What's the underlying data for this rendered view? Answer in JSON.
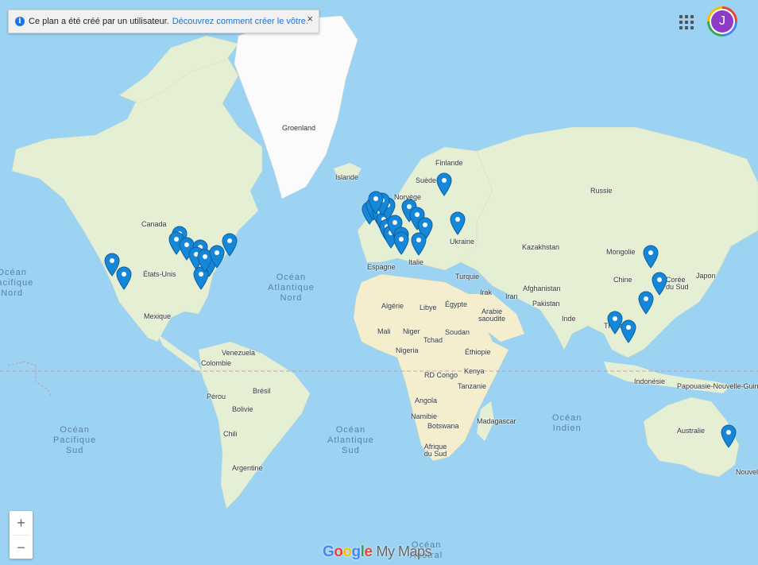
{
  "notice": {
    "text": "Ce plan a été créé par un utilisateur.",
    "link": "Découvrez comment créer le vôtre.",
    "close": "×",
    "info": "i"
  },
  "account": {
    "initial": "J"
  },
  "zoom": {
    "in": "+",
    "out": "−"
  },
  "brand": {
    "letters": [
      {
        "ch": "G",
        "color": "#4285f4"
      },
      {
        "ch": "o",
        "color": "#ea4335"
      },
      {
        "ch": "o",
        "color": "#fbbc05"
      },
      {
        "ch": "g",
        "color": "#4285f4"
      },
      {
        "ch": "l",
        "color": "#34a853"
      },
      {
        "ch": "e",
        "color": "#ea4335"
      }
    ],
    "product": "My Maps"
  },
  "colors": {
    "pin": "#1587d9",
    "land": "#e4efd4",
    "water": "#9cd3f2",
    "desert": "#f4eecf",
    "greenland": "#fbfbfb"
  },
  "ocean_labels": [
    {
      "text": "Océan\nAtlantique\nNord"
    },
    {
      "text": "Océan\nAtlantique\nSud"
    },
    {
      "text": "Océan\nPacifique\nSud"
    },
    {
      "text": "Océan\nPacifique\nNord"
    },
    {
      "text": "Océan\nIndien"
    },
    {
      "text": "Océan\nAustral"
    }
  ],
  "place_labels": [
    "Groenland",
    "Islande",
    "Finlande",
    "Suède",
    "Norvège",
    "Russie",
    "Canada",
    "États-Unis",
    "Mexique",
    "Venezuela",
    "Colombie",
    "Pérou",
    "Brésil",
    "Bolivie",
    "Chili",
    "Argentine",
    "Espagne",
    "Italie",
    "Ukraine",
    "Kazakhstan",
    "Mongolie",
    "Chine",
    "Corée du Sud",
    "Japon",
    "Turquie",
    "Irak",
    "Iran",
    "Afghanistan",
    "Pakistan",
    "Inde",
    "Arabie saoudite",
    "Égypte",
    "Libye",
    "Algérie",
    "Mali",
    "Niger",
    "Tchad",
    "Soudan",
    "Éthiopie",
    "Nigeria",
    "RD Congo",
    "Kenya",
    "Tanzanie",
    "Angola",
    "Namibie",
    "Botswana",
    "Afrique du Sud",
    "Madagascar",
    "Indonésie",
    "Papouasie-Nouvelle-Guinée",
    "Australie",
    "Thaïlande",
    "Nouvelle"
  ]
}
